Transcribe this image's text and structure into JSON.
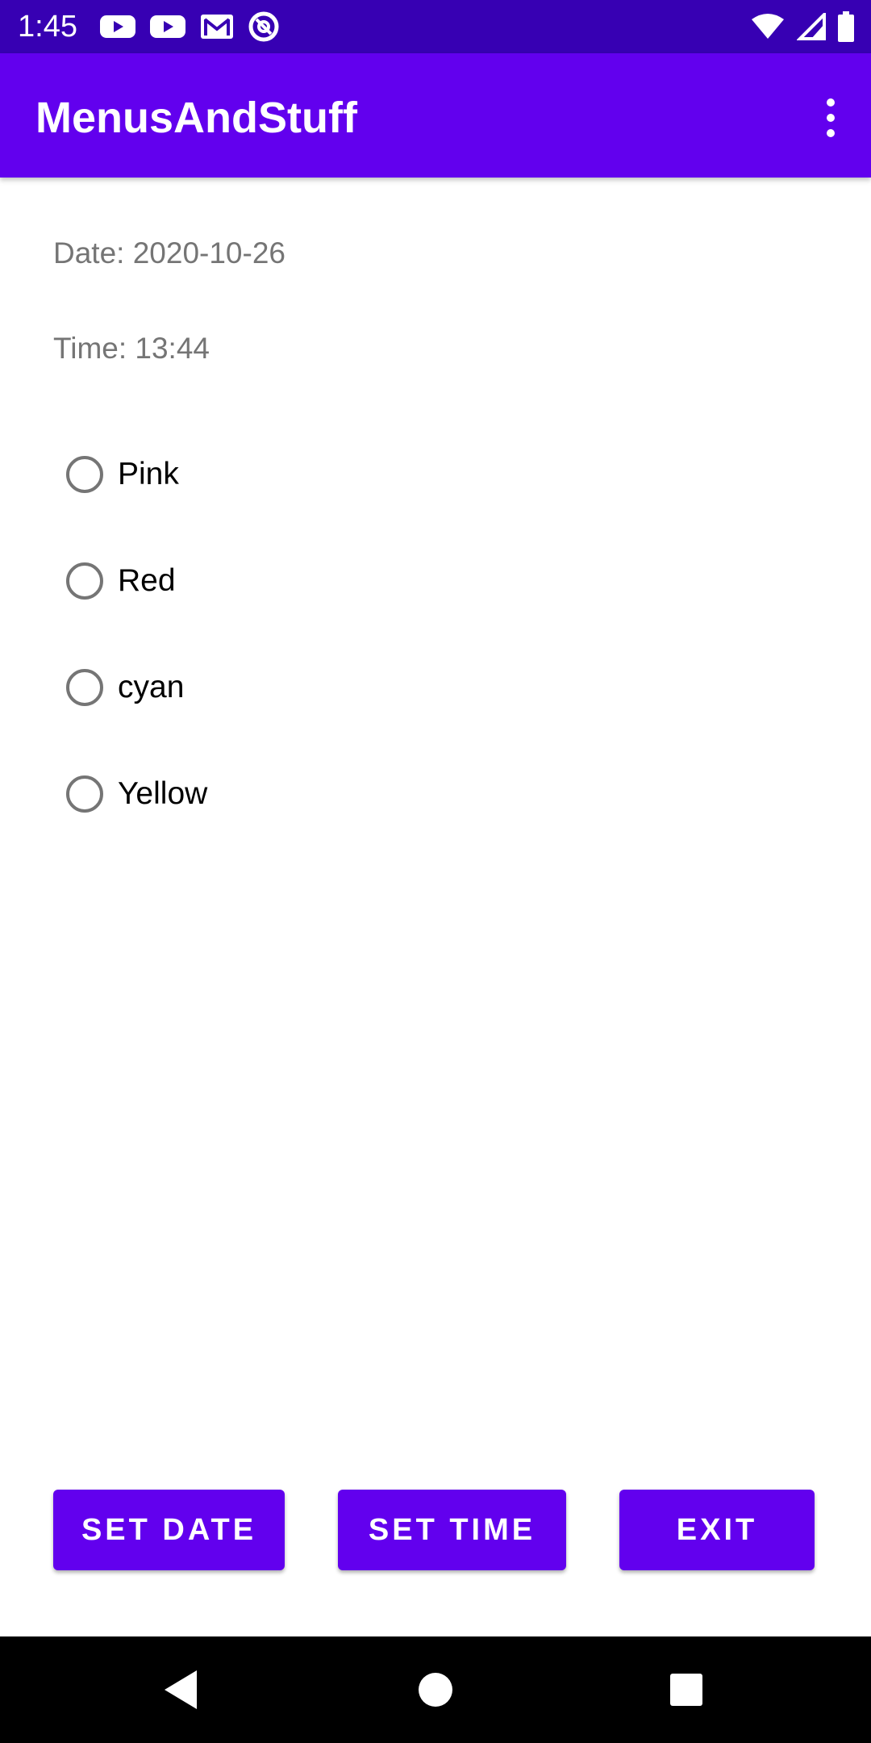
{
  "status_bar": {
    "time": "1:45",
    "left_icons": [
      "youtube-icon",
      "youtube-icon",
      "gmail-icon",
      "at-sign-icon"
    ],
    "right_icons": [
      "wifi-icon",
      "signal-icon",
      "battery-icon"
    ]
  },
  "app_bar": {
    "title": "MenusAndStuff",
    "menu_icon": "more-vert-icon"
  },
  "main": {
    "date_text": "Date: 2020-10-26",
    "time_text": "Time: 13:44",
    "radio_options": [
      {
        "label": "Pink",
        "checked": false
      },
      {
        "label": "Red",
        "checked": false
      },
      {
        "label": "cyan",
        "checked": false
      },
      {
        "label": "Yellow",
        "checked": false
      }
    ]
  },
  "buttons": {
    "set_date": "SET DATE",
    "set_time": "SET TIME",
    "exit": "EXIT"
  },
  "nav_bar": {
    "icons": [
      "back-icon",
      "home-icon",
      "recents-icon"
    ]
  },
  "colors": {
    "status_bar": "#3700B3",
    "app_bar": "#6200EE",
    "button": "#6200EE",
    "radio_outline": "#757575"
  }
}
